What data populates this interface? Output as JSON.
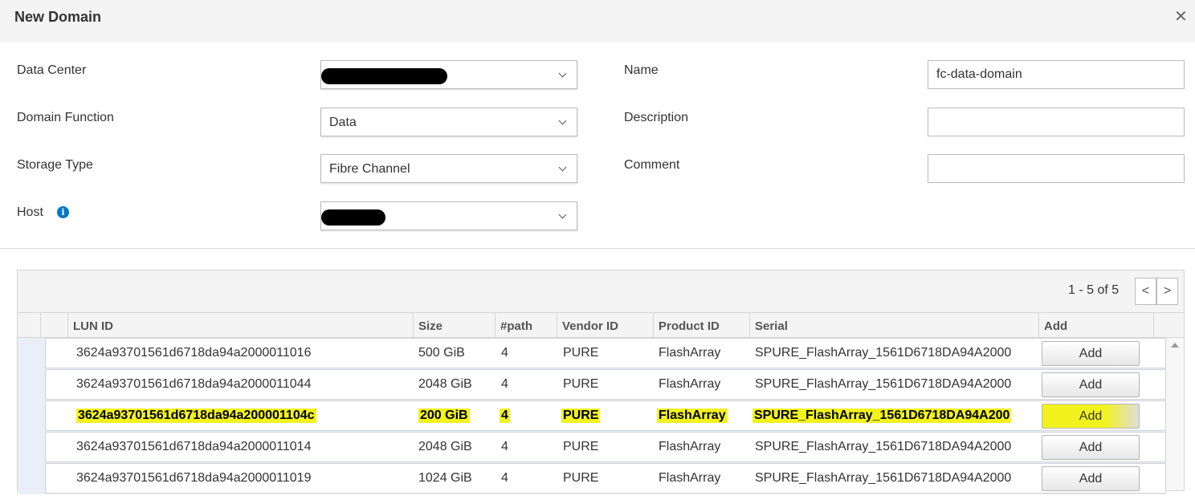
{
  "dialog": {
    "title": "New Domain"
  },
  "form": {
    "data_center_label": "Data Center",
    "domain_function_label": "Domain Function",
    "domain_function_value": "Data",
    "storage_type_label": "Storage Type",
    "storage_type_value": "Fibre Channel",
    "host_label": "Host",
    "name_label": "Name",
    "name_value": "fc-data-domain",
    "description_label": "Description",
    "description_value": "",
    "comment_label": "Comment",
    "comment_value": ""
  },
  "table": {
    "pager": "1 - 5 of 5",
    "prev_symbol": "<",
    "next_symbol": ">",
    "columns": {
      "lun_id": "LUN ID",
      "size": "Size",
      "path": "#path",
      "vendor_id": "Vendor ID",
      "product_id": "Product ID",
      "serial": "Serial",
      "add": "Add"
    },
    "rows": [
      {
        "lun_id": "3624a93701561d6718da94a2000011016",
        "size": "500 GiB",
        "path": "4",
        "vendor_id": "PURE",
        "product_id": "FlashArray",
        "serial": "SPURE_FlashArray_1561D6718DA94A2000",
        "add": "Add"
      },
      {
        "lun_id": "3624a93701561d6718da94a2000011044",
        "size": "2048 GiB",
        "path": "4",
        "vendor_id": "PURE",
        "product_id": "FlashArray",
        "serial": "SPURE_FlashArray_1561D6718DA94A2000",
        "add": "Add"
      },
      {
        "lun_id": "3624a93701561d6718da94a200001104c",
        "size": "200 GiB",
        "path": "4",
        "vendor_id": "PURE",
        "product_id": "FlashArray",
        "serial": "SPURE_FlashArray_1561D6718DA94A200",
        "add": "Add"
      },
      {
        "lun_id": "3624a93701561d6718da94a2000011014",
        "size": "2048 GiB",
        "path": "4",
        "vendor_id": "PURE",
        "product_id": "FlashArray",
        "serial": "SPURE_FlashArray_1561D6718DA94A2000",
        "add": "Add"
      },
      {
        "lun_id": "3624a93701561d6718da94a2000011019",
        "size": "1024 GiB",
        "path": "4",
        "vendor_id": "PURE",
        "product_id": "FlashArray",
        "serial": "SPURE_FlashArray_1561D6718DA94A2000",
        "add": "Add"
      }
    ]
  },
  "colors": {
    "highlight": "#f2f21f",
    "row_band": "#e9eef8",
    "header_bg": "#f4f4f5",
    "info_icon": "#0078c8"
  },
  "icons": {
    "close": "close-icon",
    "info": "info-icon",
    "chevron": "chevron-down-icon",
    "scroll_up": "scroll-up-arrow-icon"
  }
}
